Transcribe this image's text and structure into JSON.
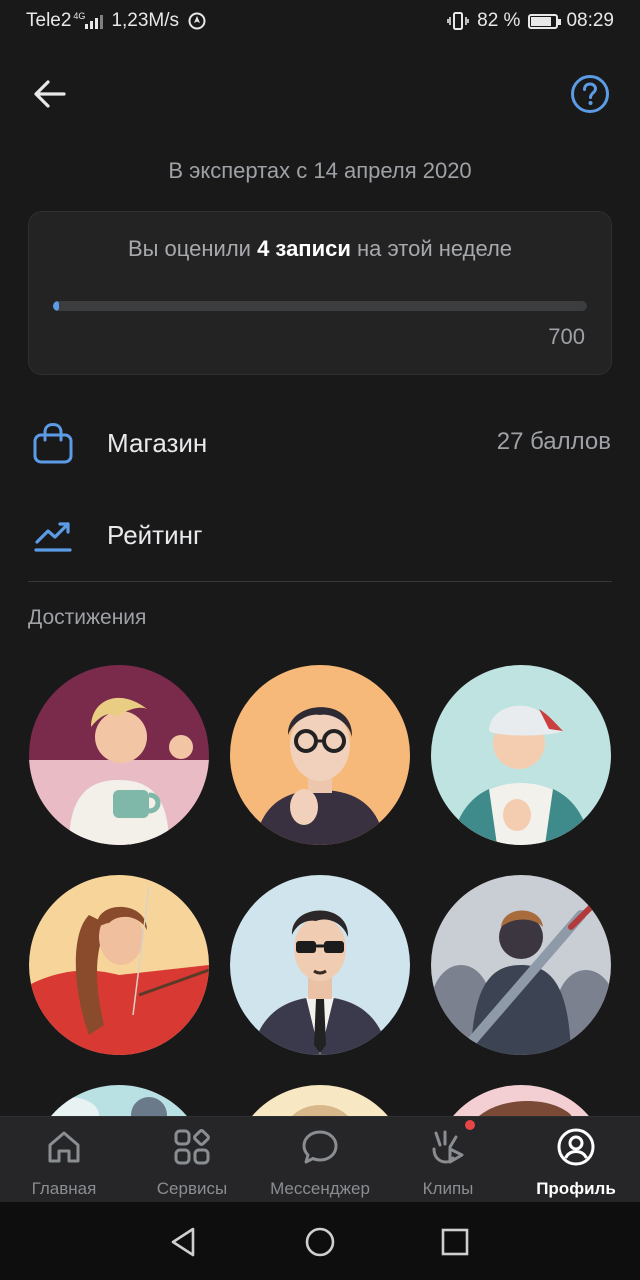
{
  "status": {
    "carrier": "Tele2",
    "network": "4G",
    "speed": "1,23M/s",
    "battery": "82 %",
    "battery_level": 0.82,
    "time": "08:29"
  },
  "header": {
    "back_icon": "arrow-left-icon",
    "help_icon": "question-circle-icon"
  },
  "expert_since": "В экспертах с 14 апреля 2020",
  "week": {
    "prefix": "Вы оценили",
    "count": "4 записи",
    "suffix": "на этой неделе",
    "progress_value": 4,
    "progress_max": 700,
    "goal": "700",
    "accent": "#5c9ce6"
  },
  "menu": {
    "shop": {
      "label": "Магазин",
      "value": "27 баллов",
      "icon": "shopping-bag-icon"
    },
    "rating": {
      "label": "Рейтинг",
      "icon": "trending-chart-icon"
    }
  },
  "achievements_title": "Достижения",
  "tabs": [
    {
      "label": "Главная",
      "icon": "home-icon"
    },
    {
      "label": "Сервисы",
      "icon": "services-grid-icon"
    },
    {
      "label": "Мессенджер",
      "icon": "chat-bubble-icon"
    },
    {
      "label": "Клипы",
      "icon": "clips-icon",
      "badge": true
    },
    {
      "label": "Профиль",
      "icon": "profile-icon",
      "active": true
    }
  ],
  "colors": {
    "background": "#19191a",
    "card": "#232324",
    "accent": "#5c9ce6",
    "badge": "#e64646"
  }
}
